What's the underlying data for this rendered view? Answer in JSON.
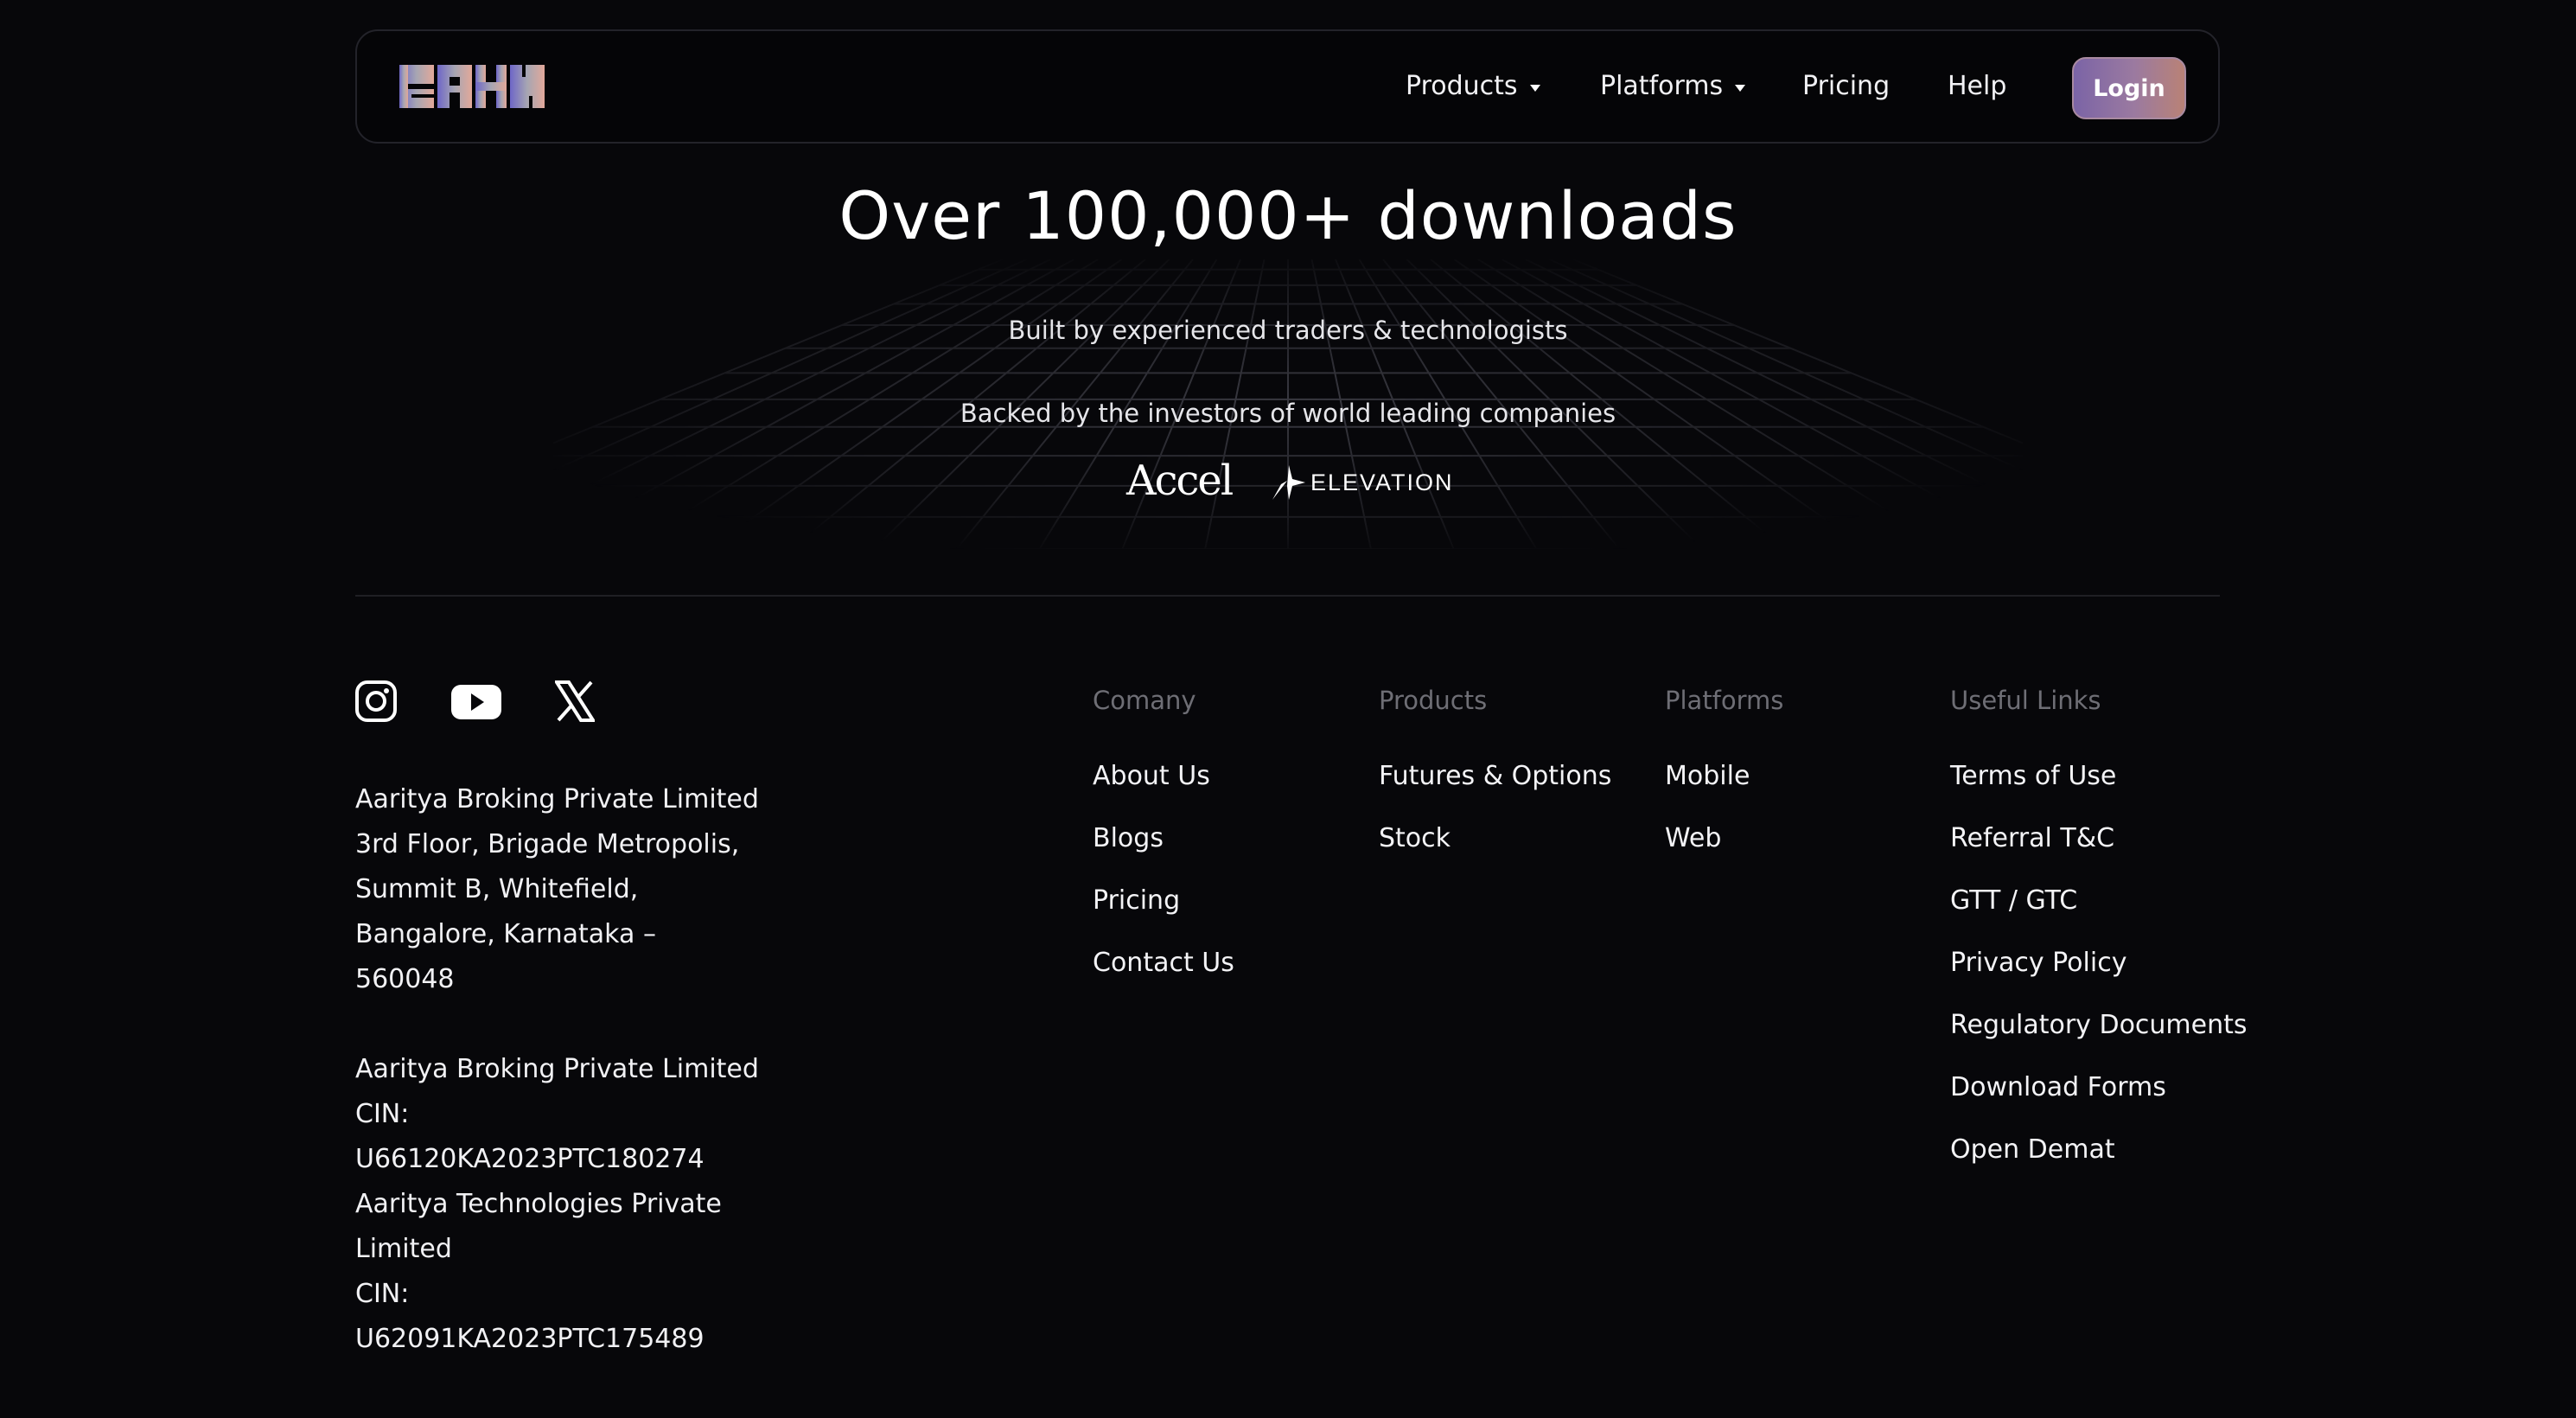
{
  "header": {
    "logo_alt": "SAHI",
    "nav": {
      "products": "Products",
      "platforms": "Platforms",
      "pricing": "Pricing",
      "help": "Help"
    },
    "login_label": "Login",
    "colors": {
      "login_from": "#7b64a6",
      "login_to": "#b98276"
    }
  },
  "hero": {
    "title": "Over 100,000+ downloads",
    "subtitle": "Built by experienced traders & technologists",
    "backed": "Backed by the investors of world leading companies",
    "investors": {
      "accel": "Accel",
      "elevation": "ELEVATION"
    }
  },
  "footer": {
    "social": [
      "instagram-icon",
      "youtube-icon",
      "x-icon"
    ],
    "address_lines": [
      "Aaritya Broking Private Limited",
      "3rd Floor, Brigade Metropolis,",
      "Summit B, Whitefield,",
      "Bangalore, Karnataka –",
      "560048"
    ],
    "cin_lines": [
      "Aaritya Broking Private Limited",
      "CIN:",
      "U66120KA2023PTC180274",
      "Aaritya Technologies Private",
      "Limited",
      "CIN:",
      "U62091KA2023PTC175489"
    ],
    "columns": {
      "company": {
        "heading": "Comany",
        "links": [
          "About Us",
          "Blogs",
          "Pricing",
          "Contact Us"
        ]
      },
      "products": {
        "heading": "Products",
        "links": [
          "Futures & Options",
          "Stock"
        ]
      },
      "platforms": {
        "heading": "Platforms",
        "links": [
          "Mobile",
          "Web"
        ]
      },
      "useful": {
        "heading": "Useful Links",
        "links": [
          "Terms of Use",
          "Referral T&C",
          "GTT / GTC",
          "Privacy Policy",
          "Regulatory Documents",
          "Download Forms",
          "Open Demat"
        ]
      }
    }
  }
}
